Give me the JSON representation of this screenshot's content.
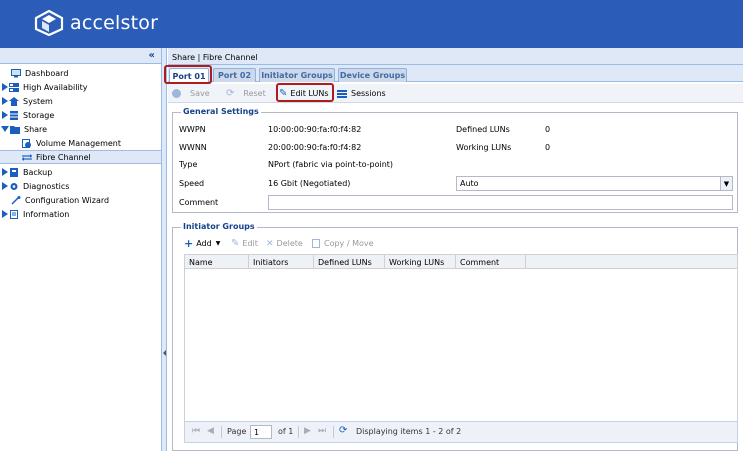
{
  "brand": {
    "name": "accelstor"
  },
  "colors": {
    "header_bg": "#2a5cb8",
    "tab_highlight": "#b01c1c",
    "link_blue": "#15428b"
  },
  "sidebar": {
    "collapse_glyph": "«",
    "items": [
      {
        "label": "Dashboard",
        "icon": "monitor-icon",
        "expander": "none",
        "indent": 0
      },
      {
        "label": "High Availability",
        "icon": "server-pair-icon",
        "expander": "collapsed",
        "indent": 0
      },
      {
        "label": "System",
        "icon": "house-icon",
        "expander": "collapsed",
        "indent": 0
      },
      {
        "label": "Storage",
        "icon": "database-icon",
        "expander": "collapsed",
        "indent": 0
      },
      {
        "label": "Share",
        "icon": "folder-open-icon",
        "expander": "expanded",
        "indent": 0
      },
      {
        "label": "Volume Management",
        "icon": "volume-icon",
        "expander": "none",
        "indent": 1
      },
      {
        "label": "Fibre Channel",
        "icon": "fibre-channel-icon",
        "expander": "none",
        "indent": 1
      },
      {
        "label": "Backup",
        "icon": "backup-icon",
        "expander": "collapsed",
        "indent": 0
      },
      {
        "label": "Diagnostics",
        "icon": "gear-icon",
        "expander": "collapsed",
        "indent": 0
      },
      {
        "label": "Configuration Wizard",
        "icon": "wand-icon",
        "expander": "none",
        "indent": 0
      },
      {
        "label": "Information",
        "icon": "document-icon",
        "expander": "collapsed",
        "indent": 0
      }
    ]
  },
  "breadcrumb": "Share | Fibre Channel",
  "tabs": [
    "Port 01",
    "Port 02",
    "Initiator Groups",
    "Device Groups"
  ],
  "toolbar": {
    "save": "Save",
    "reset": "Reset",
    "edit_luns": "Edit LUNs",
    "sessions": "Sessions"
  },
  "general": {
    "legend": "General Settings",
    "wwpn_label": "WWPN",
    "wwpn_value": "10:00:00:90:fa:f0:f4:82",
    "wwnn_label": "WWNN",
    "wwnn_value": "20:00:00:90:fa:f0:f4:82",
    "type_label": "Type",
    "type_value": "NPort (fabric via point-to-point)",
    "speed_label": "Speed",
    "speed_value": "16 Gbit (Negotiated)",
    "speed_select": "Auto",
    "comment_label": "Comment",
    "comment_value": "",
    "defined_luns_label": "Defined LUNs",
    "defined_luns_value": "0",
    "working_luns_label": "Working LUNs",
    "working_luns_value": "0"
  },
  "initiator_groups": {
    "legend": "Initiator Groups",
    "toolbar": {
      "add": "Add",
      "edit": "Edit",
      "delete": "Delete",
      "copy_move": "Copy / Move"
    },
    "columns": [
      "Name",
      "Initiators",
      "Defined LUNs",
      "Working LUNs",
      "Comment"
    ],
    "rows": [],
    "pager": {
      "page_label": "Page",
      "page_value": "1",
      "of_label": "of 1",
      "display": "Displaying items 1 - 2 of 2"
    }
  }
}
